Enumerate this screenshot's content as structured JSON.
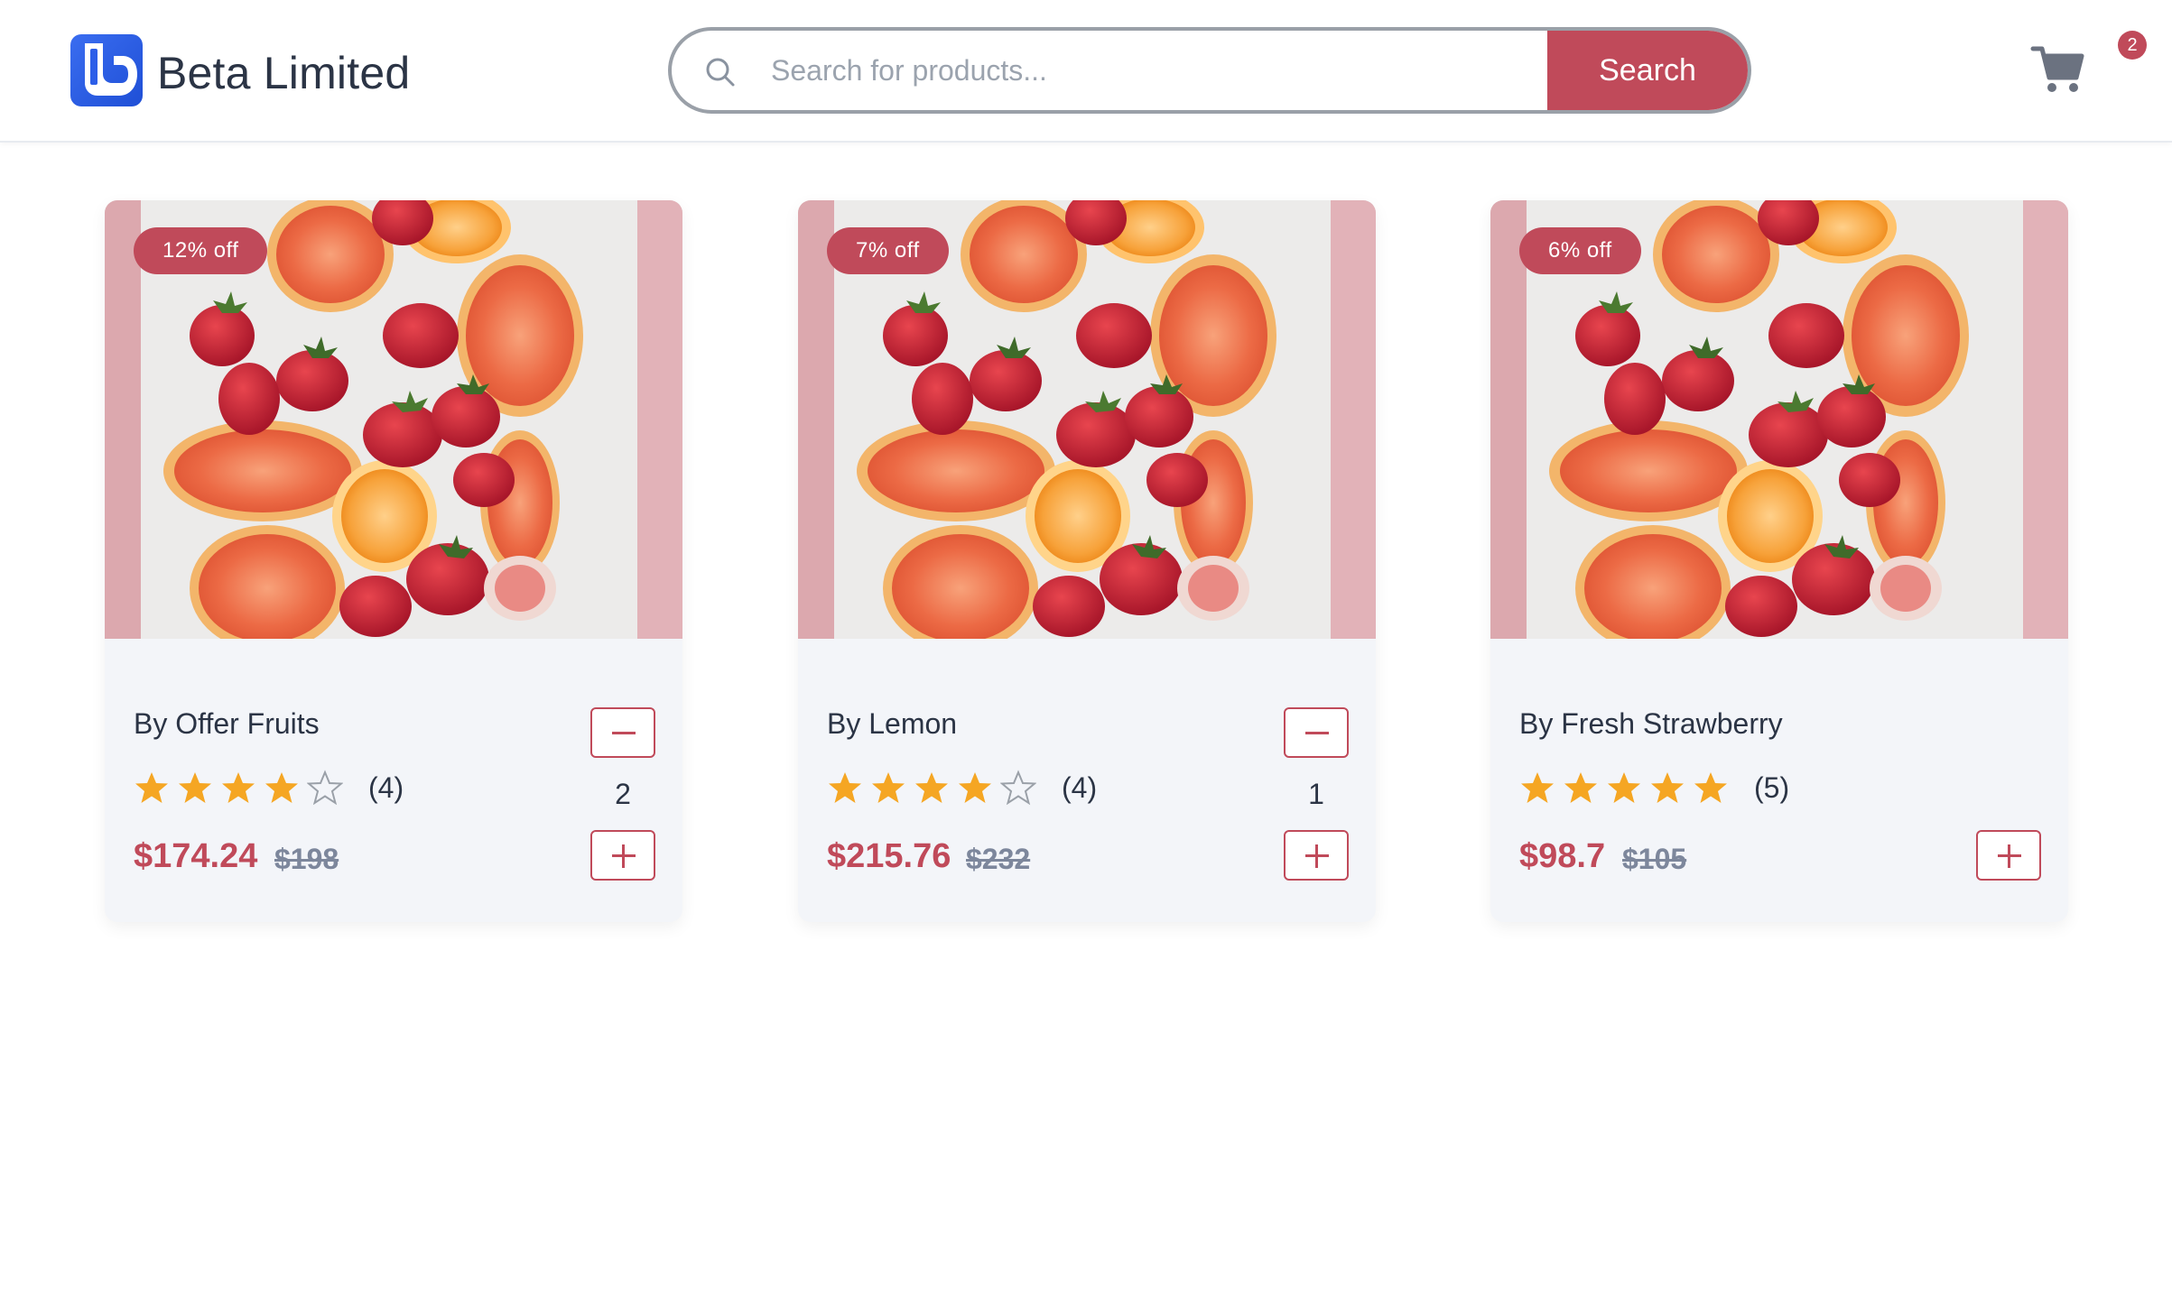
{
  "header": {
    "brand": "Beta Limited",
    "search": {
      "placeholder": "Search for products...",
      "value": "",
      "button_label": "Search"
    },
    "cart": {
      "badge_count": "2"
    }
  },
  "colors": {
    "accent": "#c04a5a",
    "logo": "#2c5ee8",
    "star": "#f5a623",
    "card_bg": "#f3f5f9"
  },
  "products": [
    {
      "title": "By Offer Fruits",
      "discount": "12% off",
      "rating": 4,
      "rating_label": "(4)",
      "price": "$174.24",
      "old_price": "$198",
      "quantity": "2",
      "image": "fruit-photo"
    },
    {
      "title": "By Lemon",
      "discount": "7% off",
      "rating": 4,
      "rating_label": "(4)",
      "price": "$215.76",
      "old_price": "$232",
      "quantity": "1",
      "image": "fruit-photo"
    },
    {
      "title": "By Fresh Strawberry",
      "discount": "6% off",
      "rating": 5,
      "rating_label": "(5)",
      "price": "$98.7",
      "old_price": "$105",
      "quantity": "",
      "image": "fruit-photo"
    }
  ]
}
